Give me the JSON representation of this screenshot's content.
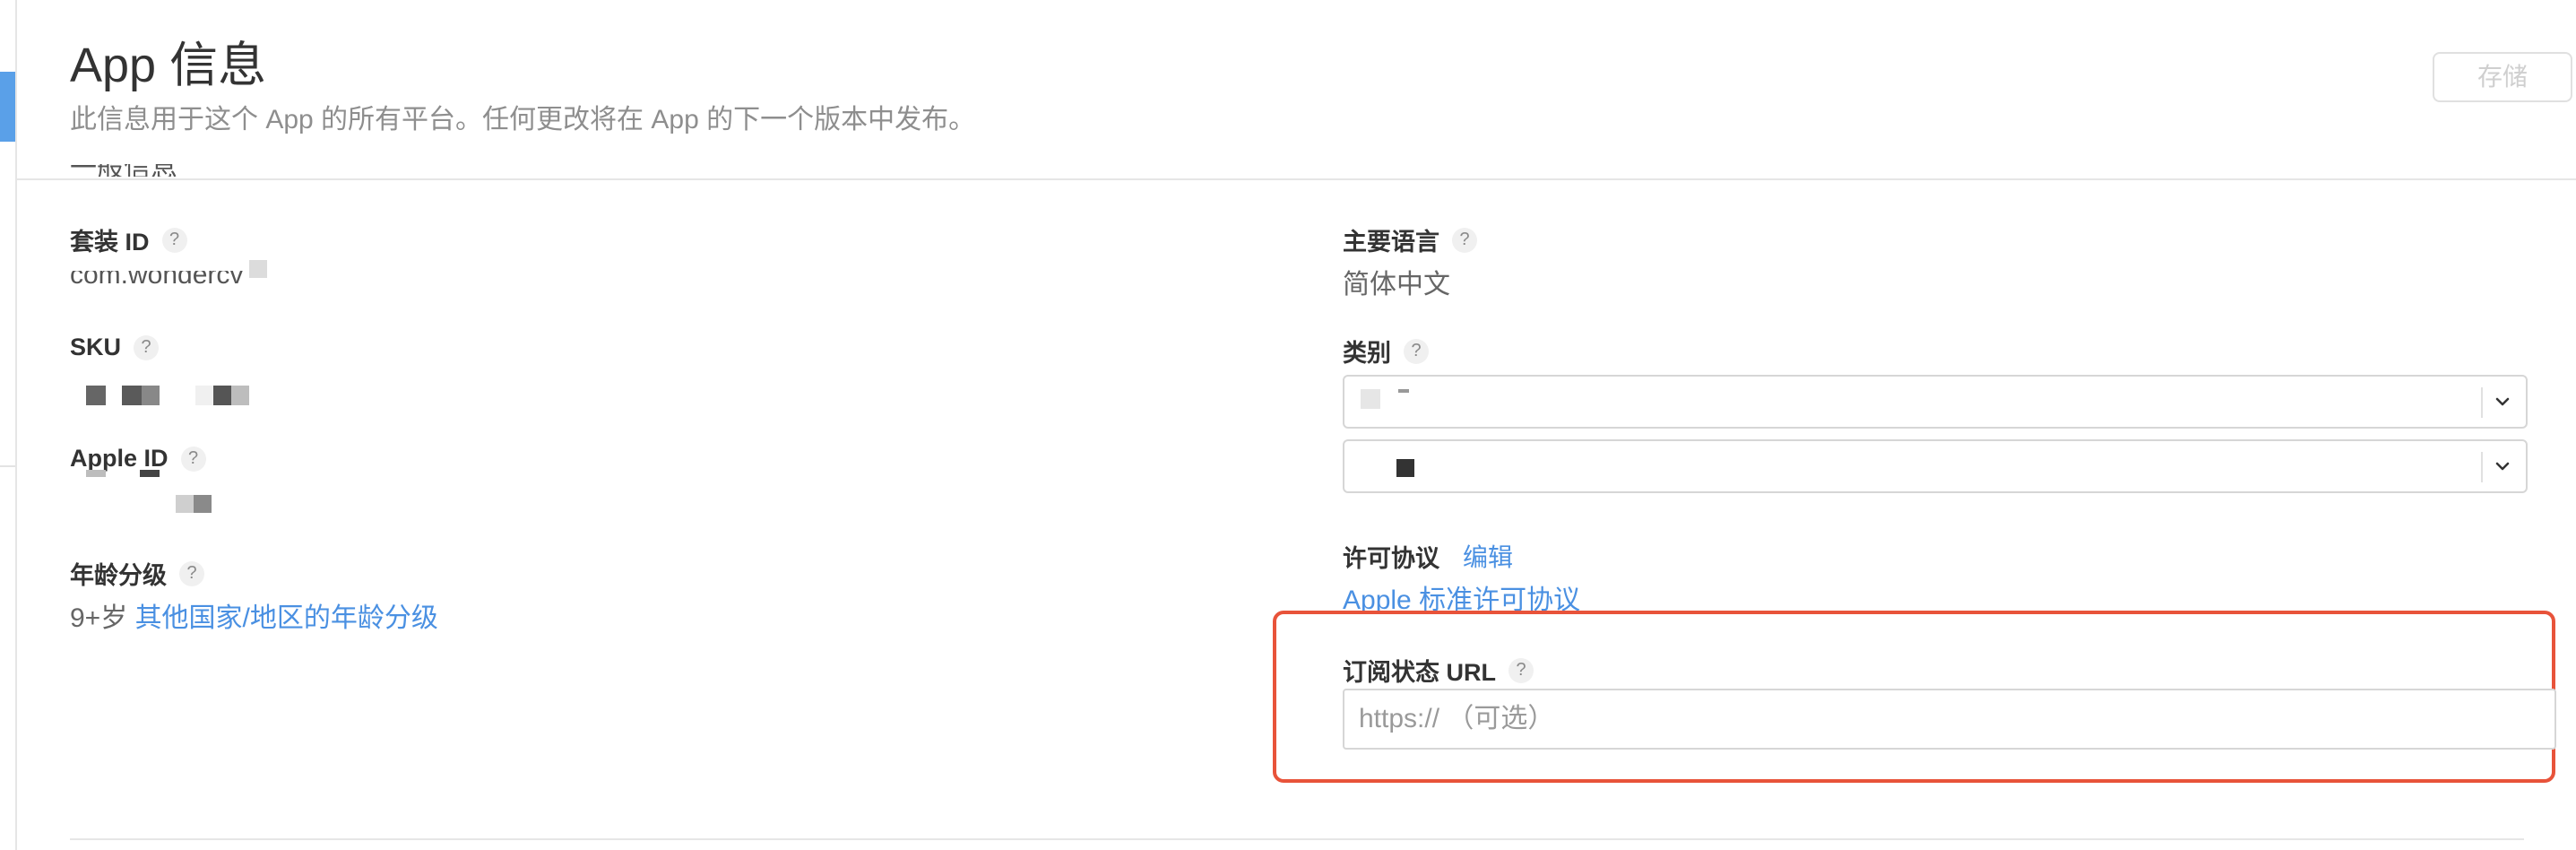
{
  "header": {
    "title": "App 信息",
    "subtitle": "此信息用于这个 App 的所有平台。任何更改将在 App 的下一个版本中发布。",
    "save_label": "存储"
  },
  "left_column": {
    "bundle_id": {
      "label": "套装 ID",
      "value": "com.wondercv"
    },
    "sku": {
      "label": "SKU"
    },
    "apple_id": {
      "label": "Apple ID"
    },
    "age_rating": {
      "label": "年龄分级",
      "value": "9+岁",
      "link": "其他国家/地区的年龄分级"
    }
  },
  "right_column": {
    "primary_language": {
      "label": "主要语言",
      "value": "简体中文"
    },
    "category": {
      "label": "类别"
    },
    "license": {
      "label": "许可协议",
      "edit_link": "编辑",
      "value_link": "Apple 标准许可协议"
    },
    "subscription_url": {
      "label": "订阅状态 URL",
      "placeholder": "https:// （可选）"
    }
  },
  "help_glyph": "?",
  "colors": {
    "link": "#4a90e2",
    "highlight": "#e8533a",
    "sidebar_active": "#5aa0e8"
  },
  "icons": [
    "help-icon",
    "chevron-down-icon"
  ]
}
